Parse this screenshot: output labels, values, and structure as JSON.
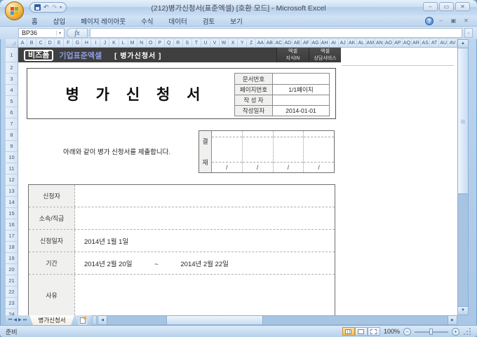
{
  "colors": {
    "banner_bg": "#3f3f3f",
    "brand_blue": "#8b9ce0",
    "frame_blue": "#a9c6e5",
    "form_border": "#6e6e6e",
    "label_bg": "#f0f0ee"
  },
  "title_bar": {
    "title": "(212)병가신청서(표준엑셀) [호환 모드] - Microsoft Excel"
  },
  "window_controls": {
    "minimize": "–",
    "restore": "▭",
    "close": "✕"
  },
  "ribbon": {
    "tabs": [
      "홈",
      "삽입",
      "페이지 레이아웃",
      "수식",
      "데이터",
      "검토",
      "보기"
    ],
    "help": "?"
  },
  "workbook_controls": {
    "minimize": "–",
    "restore": "▣",
    "close": "✕"
  },
  "formula_bar": {
    "name_box": "BP36",
    "fx": "fx",
    "formula": ""
  },
  "grid": {
    "columns": [
      "A",
      "B",
      "C",
      "D",
      "E",
      "F",
      "G",
      "H",
      "I",
      "J",
      "K",
      "L",
      "M",
      "N",
      "O",
      "P",
      "Q",
      "R",
      "S",
      "T",
      "U",
      "V",
      "W",
      "X",
      "Y",
      "Z",
      "AA",
      "AB",
      "AC",
      "AD",
      "AE",
      "AF",
      "AG",
      "AH",
      "AI",
      "AJ",
      "AK",
      "AL",
      "AM",
      "AN",
      "AO",
      "AP",
      "AQ",
      "AR",
      "AS",
      "AT",
      "AU",
      "AV"
    ],
    "rows": [
      "1",
      "2",
      "3",
      "4",
      "5",
      "6",
      "7",
      "8",
      "9",
      "10",
      "11",
      "12",
      "13",
      "14",
      "15",
      "16",
      "17",
      "18",
      "19",
      "20",
      "21",
      "22",
      "23",
      "24"
    ]
  },
  "banner": {
    "logo": "비즈폼",
    "brand_sub": "기업표준엑셀",
    "doc_label": "[ 병가신청서 ]",
    "buttons": [
      {
        "line1": "엑셀",
        "line2": "지식IN"
      },
      {
        "line1": "엑셀",
        "line2": "상담서비스"
      }
    ]
  },
  "form": {
    "title": "병 가 신 청 서",
    "info_rows": [
      {
        "label": "문서번호",
        "value": ""
      },
      {
        "label": "페이지번호",
        "value": "1/1페이지"
      },
      {
        "label": "작 성 자",
        "value": ""
      },
      {
        "label": "작성일자",
        "value": "2014-01-01"
      }
    ],
    "statement": "아래와 같이 병가 신청서를 제출합니다.",
    "approval": {
      "label_top": "결",
      "label_bottom": "재",
      "cells": [
        "/",
        "/",
        "/",
        "/"
      ]
    },
    "rows": [
      {
        "label": "신청자",
        "value": ""
      },
      {
        "label": "소속/직급",
        "value": ""
      },
      {
        "label": "신청일자",
        "value": "2014년 1월 1일"
      },
      {
        "label": "기간",
        "value": "2014년 2월 20일            ~            2014년 2월 22일"
      },
      {
        "label": "사유",
        "value": ""
      }
    ]
  },
  "sheet_tabs": {
    "active": "병가신청서"
  },
  "status_bar": {
    "ready": "준비",
    "zoom": "100%"
  }
}
